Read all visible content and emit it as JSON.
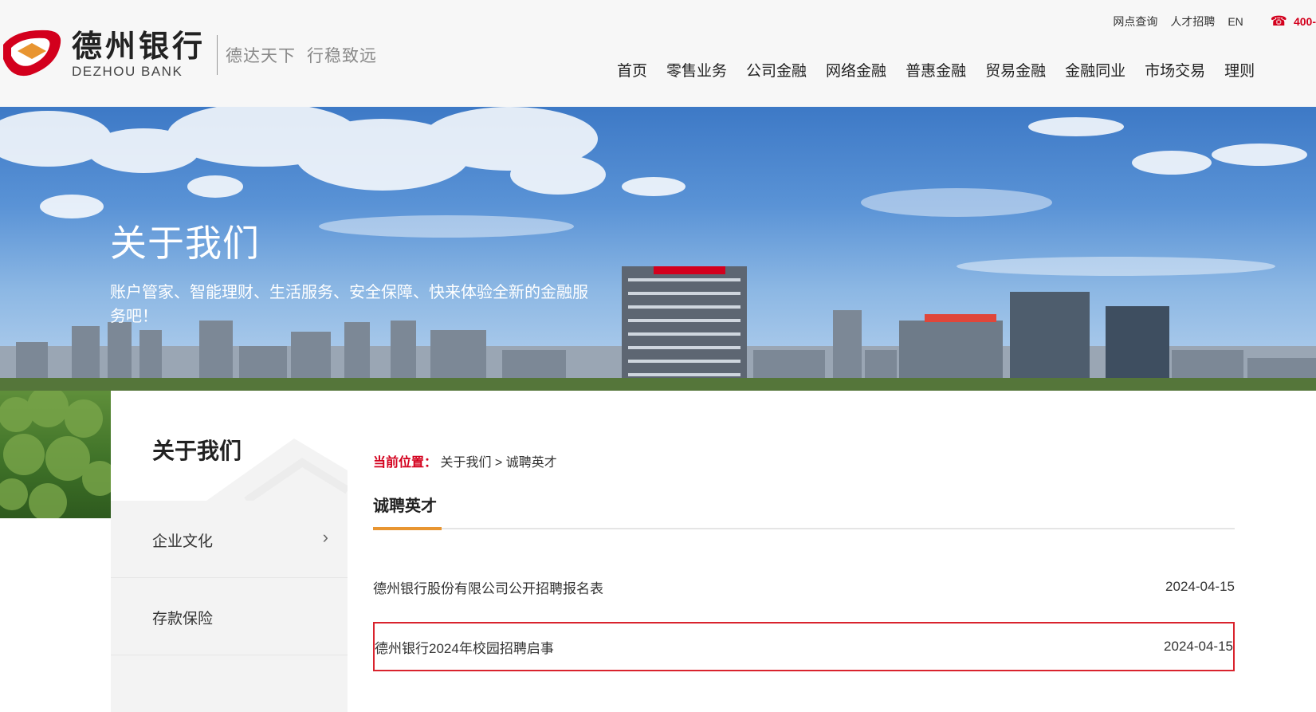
{
  "header": {
    "logo_cn": "德州银行",
    "logo_en": "DEZHOU BANK",
    "slogan": [
      "德达天下",
      "行稳致远"
    ],
    "top_links": [
      "网点查询",
      "人才招聘",
      "EN"
    ],
    "phone": "400-",
    "nav": [
      "首页",
      "零售业务",
      "公司金融",
      "网络金融",
      "普惠金融",
      "贸易金融",
      "金融同业",
      "市场交易",
      "理则"
    ]
  },
  "banner": {
    "title": "关于我们",
    "subtitle": "账户管家、智能理财、生活服务、安全保障、快来体验全新的金融服务吧！"
  },
  "sidebar": {
    "title": "关于我们",
    "items": [
      {
        "label": "企业文化"
      },
      {
        "label": "存款保险"
      }
    ]
  },
  "main": {
    "breadcrumb_label": "当前位置：",
    "breadcrumb_path": "关于我们 > 诚聘英才",
    "section_title": "诚聘英才",
    "rows": [
      {
        "title": "德州银行股份有限公司公开招聘报名表",
        "date": "2024-04-15"
      },
      {
        "title": "德州银行2024年校园招聘启事",
        "date": "2024-04-15"
      }
    ]
  },
  "colors": {
    "brand_red": "#d3001d",
    "accent_orange": "#e89531",
    "highlight_border": "#d9232d"
  }
}
